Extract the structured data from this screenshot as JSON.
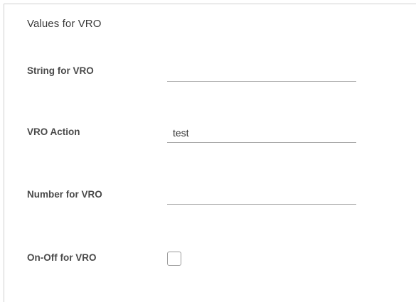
{
  "form": {
    "section_title": "Values for VRO",
    "fields": [
      {
        "label": "String for VRO",
        "type": "text",
        "value": ""
      },
      {
        "label": "VRO Action",
        "type": "text",
        "value": "test"
      },
      {
        "label": "Number for VRO",
        "type": "text",
        "value": ""
      },
      {
        "label": "On-Off for VRO",
        "type": "checkbox",
        "checked": false
      }
    ]
  }
}
